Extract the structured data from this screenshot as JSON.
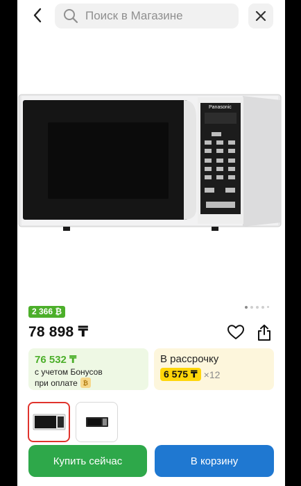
{
  "header": {
    "search_placeholder": "Поиск в Магазине"
  },
  "product": {
    "brand_on_image": "Panasonic",
    "bonus_badge": "2 366 ₿",
    "price": "78 898 ₸",
    "image_count": 5,
    "active_image_index": 0
  },
  "offers": {
    "bonus": {
      "price": "76 532 ₸",
      "line1": "с учетом Бонусов",
      "line2": "при оплате"
    },
    "installment": {
      "title": "В рассрочку",
      "amount": "6 575 ₸",
      "multiplier": "×12"
    }
  },
  "actions": {
    "buy_now": "Купить сейчас",
    "add_to_cart": "В корзину"
  },
  "colors": {
    "green": "#2ea84a",
    "blue": "#1f78d1",
    "bonus_green": "#4caf2a",
    "yellow": "#ffd60a",
    "selected_red": "#e0332c"
  }
}
